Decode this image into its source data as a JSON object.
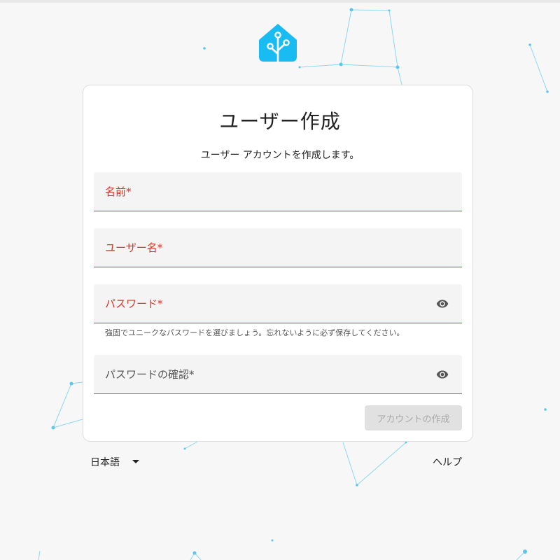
{
  "theme": {
    "accent": "#18bcf2",
    "error": "#d9342b",
    "network_line": "#8fd7f2"
  },
  "logo": {
    "icon": "home-assistant-logo-icon"
  },
  "card": {
    "title": "ユーザー作成",
    "subtitle": "ユーザー アカウントを作成します。"
  },
  "fields": {
    "name": {
      "label": "名前*",
      "value": ""
    },
    "username": {
      "label": "ユーザー名*",
      "value": ""
    },
    "password": {
      "label": "パスワード*",
      "value": "",
      "helper": "強固でユニークなパスワードを選びましょう。忘れないように必ず保存してください。",
      "icon": "eye-icon"
    },
    "password_confirm": {
      "label": "パスワードの確認*",
      "value": "",
      "icon": "eye-icon"
    }
  },
  "actions": {
    "create_label": "アカウントの作成"
  },
  "footer": {
    "language": "日本語",
    "language_icon": "caret-down-icon",
    "help": "ヘルプ"
  }
}
